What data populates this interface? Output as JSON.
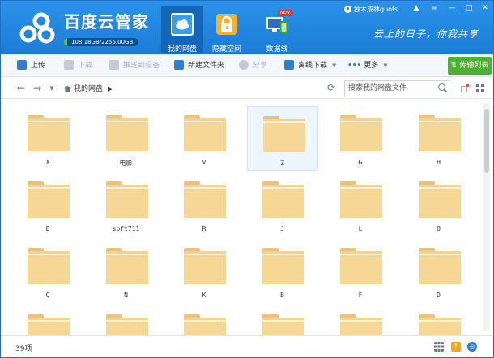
{
  "header": {
    "brand": "百度云管家",
    "quota": "108.18GB/2255.00GB",
    "quota_used_fraction": 0.048,
    "tabs": [
      {
        "label": "我的网盘",
        "active": true
      },
      {
        "label": "隐藏空间",
        "active": false
      },
      {
        "label": "数据线",
        "active": false,
        "badge": "NEW"
      }
    ],
    "user": "独木成林guofs",
    "slogan": "云上的日子，你我共享"
  },
  "toolbar": {
    "upload": "上传",
    "download": "下载",
    "push": "推送到设备",
    "new_folder": "新建文件夹",
    "share": "分享",
    "offline": "离线下载",
    "more": "更多",
    "transfer": "传输列表"
  },
  "address": {
    "crumb": "我的网盘",
    "search_placeholder": "搜索我的网盘文件"
  },
  "folders": [
    "X",
    "电影",
    "V",
    "Z",
    "G",
    "H",
    "E",
    "soft711",
    "R",
    "J",
    "L",
    "O",
    "Q",
    "N",
    "K",
    "B",
    "F",
    "D",
    "",
    "",
    "",
    "",
    "",
    ""
  ],
  "selected_folder": "Z",
  "status": {
    "count": "39项"
  },
  "colors": {
    "header": "#1c7cd6",
    "folder": "#f5d28f",
    "transfer": "#4db133"
  }
}
